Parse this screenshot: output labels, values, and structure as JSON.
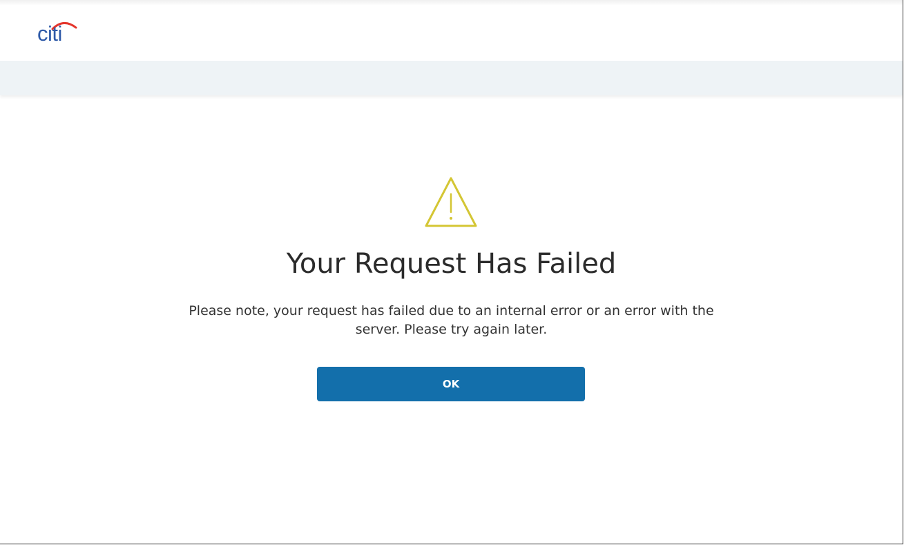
{
  "brand": {
    "logo_text": "citi",
    "logo_color": "#2e5aa8",
    "arc_color": "#e4352c"
  },
  "error": {
    "icon": "warning-icon",
    "icon_color": "#d4c634",
    "title": "Your Request Has Failed",
    "message": "Please note, your request has failed due to an internal error or an error with the server. Please try again later.",
    "ok_label": "OK",
    "button_color": "#136fab"
  },
  "colors": {
    "subbar": "#eef3f6",
    "text": "#2b2b2b"
  }
}
